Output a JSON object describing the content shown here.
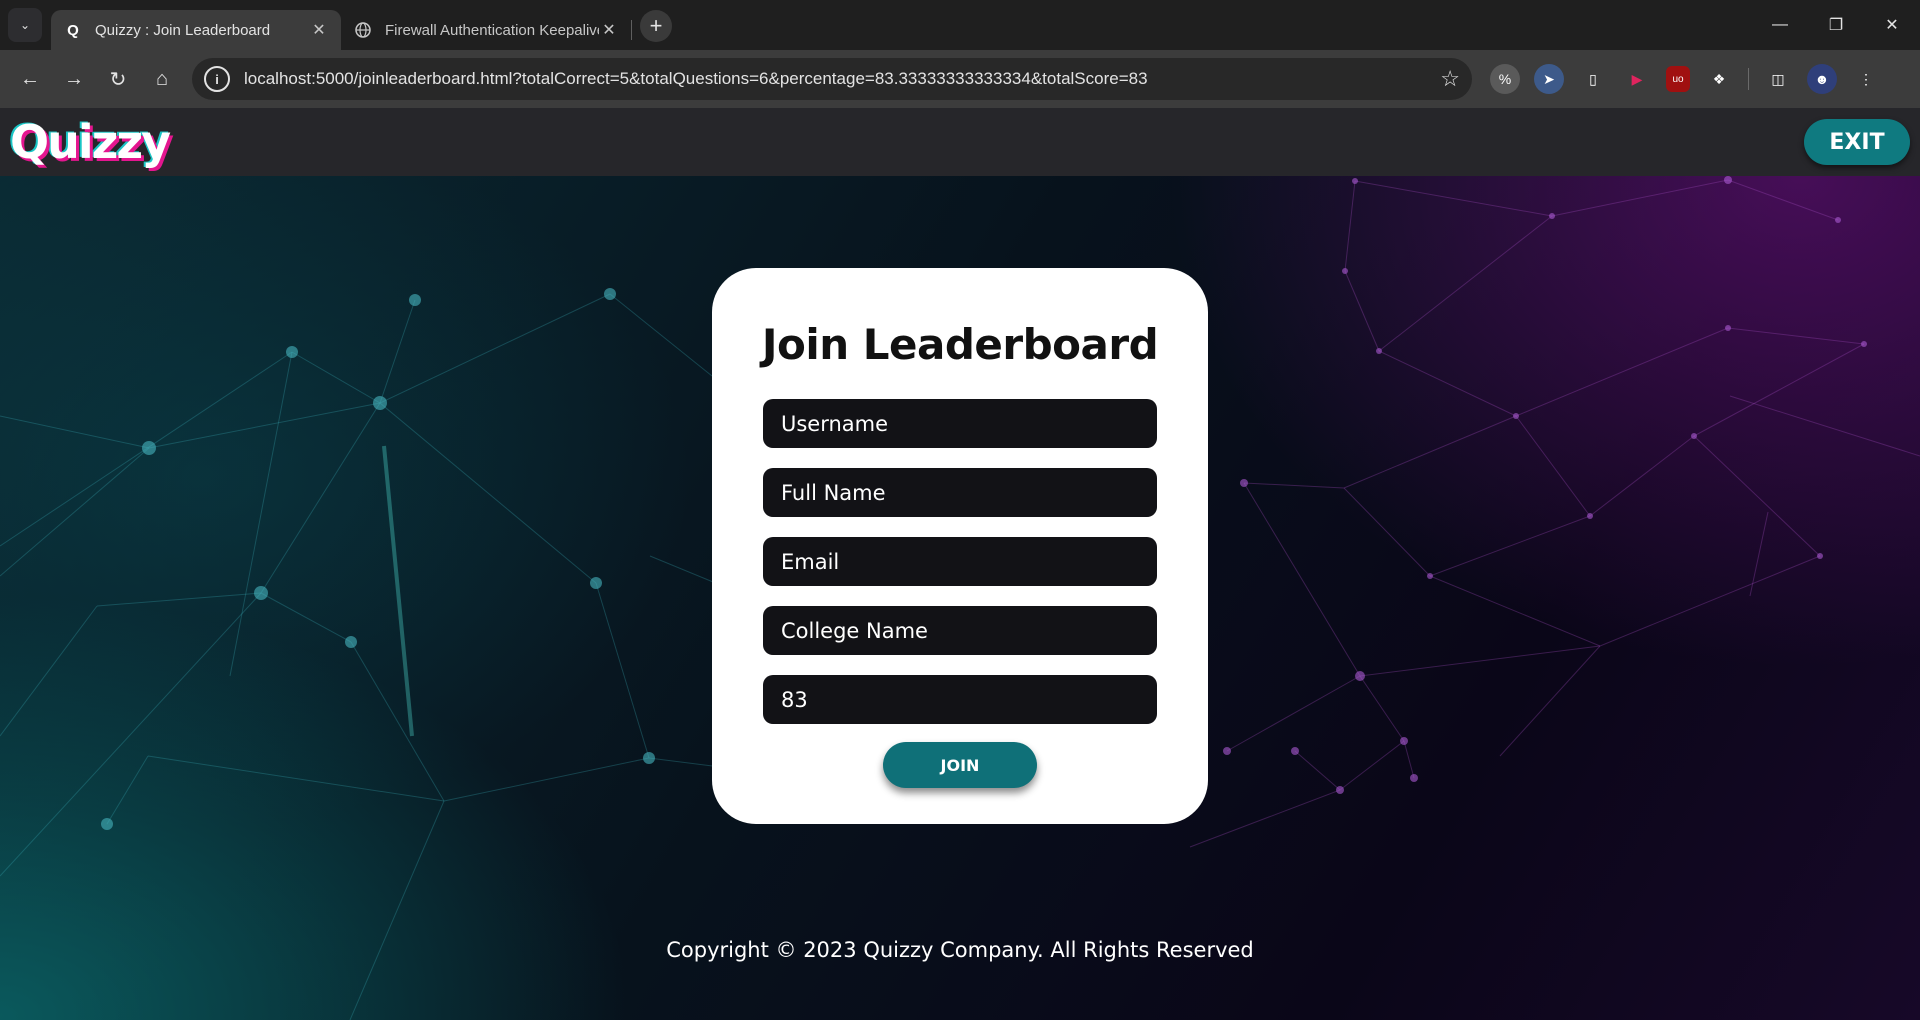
{
  "browser": {
    "tabs": [
      {
        "title": "Quizzy : Join Leaderboard",
        "favicon": "Q",
        "active": true
      },
      {
        "title": "Firewall Authentication Keepalive",
        "favicon": "globe-icon",
        "active": false
      }
    ],
    "url": "localhost:5000/joinleaderboard.html?totalCorrect=5&totalQuestions=6&percentage=83.33333333333334&totalScore=83"
  },
  "site": {
    "logo": "Quizzy",
    "exit_label": "EXIT"
  },
  "form": {
    "title": "Join Leaderboard",
    "username_placeholder": "Username",
    "fullname_placeholder": "Full Name",
    "email_placeholder": "Email",
    "college_placeholder": "College Name",
    "score_value": "83",
    "join_label": "JOIN"
  },
  "footer": {
    "copyright": "Copyright © 2023 Quizzy Company. All Rights Reserved"
  },
  "colors": {
    "accent": "#0f7a80",
    "card": "#ffffff",
    "field_bg": "#121216"
  }
}
